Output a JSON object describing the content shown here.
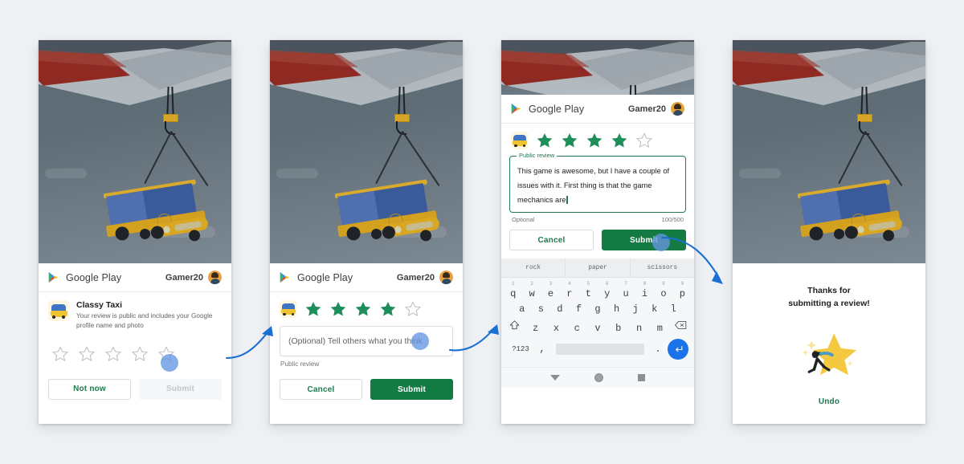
{
  "background_color": "#eef0f4",
  "accent_colors": {
    "green": "#137a43",
    "green_text": "#1e7a4d",
    "blue_arrow": "#1a6fd4",
    "touch_indicator": "#6596e2",
    "star_yellow": "#f5c93f",
    "keyboard_enter_blue": "#1a73e8"
  },
  "header": {
    "logo_icon": "google-play-logo-icon",
    "title": "Google Play",
    "user_name": "Gamer20",
    "avatar_icon": "user-avatar-icon"
  },
  "panel1": {
    "app": {
      "icon": "classy-taxi-app-icon",
      "name": "Classy Taxi",
      "subtitle": "Your review is public and includes your Google profile name and photo"
    },
    "rating": {
      "filled": 0,
      "total": 5,
      "star_icon": "star-outline-icon"
    },
    "buttons": {
      "not_now": "Not now",
      "submit": "Submit",
      "submit_disabled": true
    }
  },
  "panel2": {
    "rating": {
      "filled": 4,
      "total": 5,
      "app_icon": "classy-taxi-app-icon",
      "star_filled_icon": "star-filled-icon",
      "star_empty_icon": "star-outline-icon"
    },
    "review_input": {
      "placeholder": "(Optional) Tell others what you think",
      "value": "",
      "helper": "Public review"
    },
    "buttons": {
      "cancel": "Cancel",
      "submit": "Submit"
    }
  },
  "panel3": {
    "rating": {
      "filled": 4,
      "total": 5,
      "app_icon": "classy-taxi-app-icon"
    },
    "review_input": {
      "legend": "Public review",
      "value": "This game is awesome, but I have a couple of issues with it. First thing is that the game mechanics are",
      "helper": "Optional",
      "counter": "100/500"
    },
    "buttons": {
      "cancel": "Cancel",
      "submit": "Submit"
    },
    "keyboard": {
      "suggestions": [
        "rock",
        "paper",
        "scissors"
      ],
      "row1_numbers": [
        "1",
        "2",
        "3",
        "4",
        "5",
        "6",
        "7",
        "8",
        "9",
        "0"
      ],
      "row1": [
        "q",
        "w",
        "e",
        "r",
        "t",
        "y",
        "u",
        "i",
        "o",
        "p"
      ],
      "row2": [
        "a",
        "s",
        "d",
        "f",
        "g",
        "h",
        "j",
        "k",
        "l"
      ],
      "row3": [
        "z",
        "x",
        "c",
        "v",
        "b",
        "n",
        "m"
      ],
      "shift_icon": "shift-arrow-icon",
      "backspace_icon": "backspace-icon",
      "symbols_key": "?123",
      "comma_key": ",",
      "period_key": ".",
      "space_key": "",
      "enter_icon": "enter-return-icon"
    },
    "navbar": {
      "back_icon": "nav-back-icon",
      "home_icon": "nav-home-icon",
      "recents_icon": "nav-recents-icon"
    }
  },
  "panel4": {
    "thanks_line1": "Thanks for",
    "thanks_line2": "submitting a review!",
    "illustration_icon": "star-celebration-icon",
    "undo": "Undo"
  },
  "flow_arrows": [
    {
      "name": "arrow-panel1-to-panel2"
    },
    {
      "name": "arrow-panel2-to-panel3"
    },
    {
      "name": "arrow-panel3-to-panel4"
    }
  ]
}
